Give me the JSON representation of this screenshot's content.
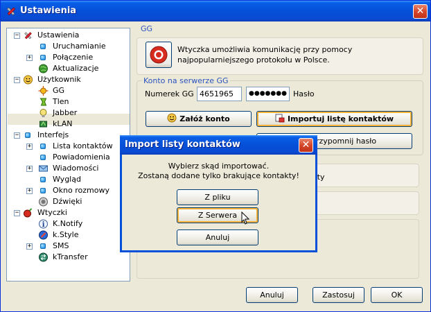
{
  "window": {
    "title": "Ustawienia",
    "close_glyph": "✕"
  },
  "tree": {
    "items": [
      {
        "label": "Ustawienia",
        "icon": "tools-icon",
        "expander": "⊟"
      },
      {
        "label": "Uruchamianie",
        "icon": "bullet-icon"
      },
      {
        "label": "Połączenie",
        "icon": "bullet-icon",
        "expander": "+"
      },
      {
        "label": "Aktualizacje",
        "icon": "globe-icon"
      },
      {
        "label": "Użytkownik",
        "icon": "user-smiley-icon",
        "expander": "⊟"
      },
      {
        "label": "GG",
        "icon": "gg-sun-icon"
      },
      {
        "label": "Tlen",
        "icon": "tlen-icon"
      },
      {
        "label": "Jabber",
        "icon": "jabber-bulb-icon"
      },
      {
        "label": "kLAN",
        "icon": "klan-icon"
      },
      {
        "label": "Interfejs",
        "icon": "bullet-icon",
        "expander": "⊟"
      },
      {
        "label": "Lista kontaktów",
        "icon": "bullet-icon",
        "expander": "+"
      },
      {
        "label": "Powiadomienia",
        "icon": "bullet-icon"
      },
      {
        "label": "Wiadomości",
        "icon": "envelope-icon",
        "expander": "+"
      },
      {
        "label": "Wygląd",
        "icon": "bullet-icon"
      },
      {
        "label": "Okno rozmowy",
        "icon": "bullet-icon",
        "expander": "+"
      },
      {
        "label": "Dźwięki",
        "icon": "speaker-icon"
      },
      {
        "label": "Wtyczki",
        "icon": "plugin-icon",
        "expander": "⊟"
      },
      {
        "label": "K.Notify",
        "icon": "info-icon"
      },
      {
        "label": "k.Style",
        "icon": "style-icon"
      },
      {
        "label": "SMS",
        "icon": "bullet-icon",
        "expander": "+"
      },
      {
        "label": "kTransfer",
        "icon": "transfer-icon"
      }
    ]
  },
  "gg": {
    "section_title": "GG",
    "description": "Wtyczka umożliwia komunikację przy pomocy najpopularniejszego protokołu w Polsce.",
    "account_group": "Konto na serwerze GG",
    "number_label": "Numerek GG",
    "number_value": "4651965",
    "password_value": "●●●●●●●",
    "password_label": "Hasło",
    "create_account": "Załóż konto",
    "import_contacts": "Importuj listę kontaktów",
    "remind_password_partial": "rzypomnij hasło",
    "bg_text_partial": "sty"
  },
  "dialog": {
    "title": "Import listy kontaktów",
    "line1": "Wybierz skąd importować.",
    "line2": "Zostaną dodane tylko brakujące kontakty!",
    "from_file": "Z pliku",
    "from_server": "Z Serwera",
    "cancel": "Anuluj"
  },
  "footer": {
    "cancel": "Anuluj",
    "apply": "Zastosuj",
    "ok": "OK"
  }
}
